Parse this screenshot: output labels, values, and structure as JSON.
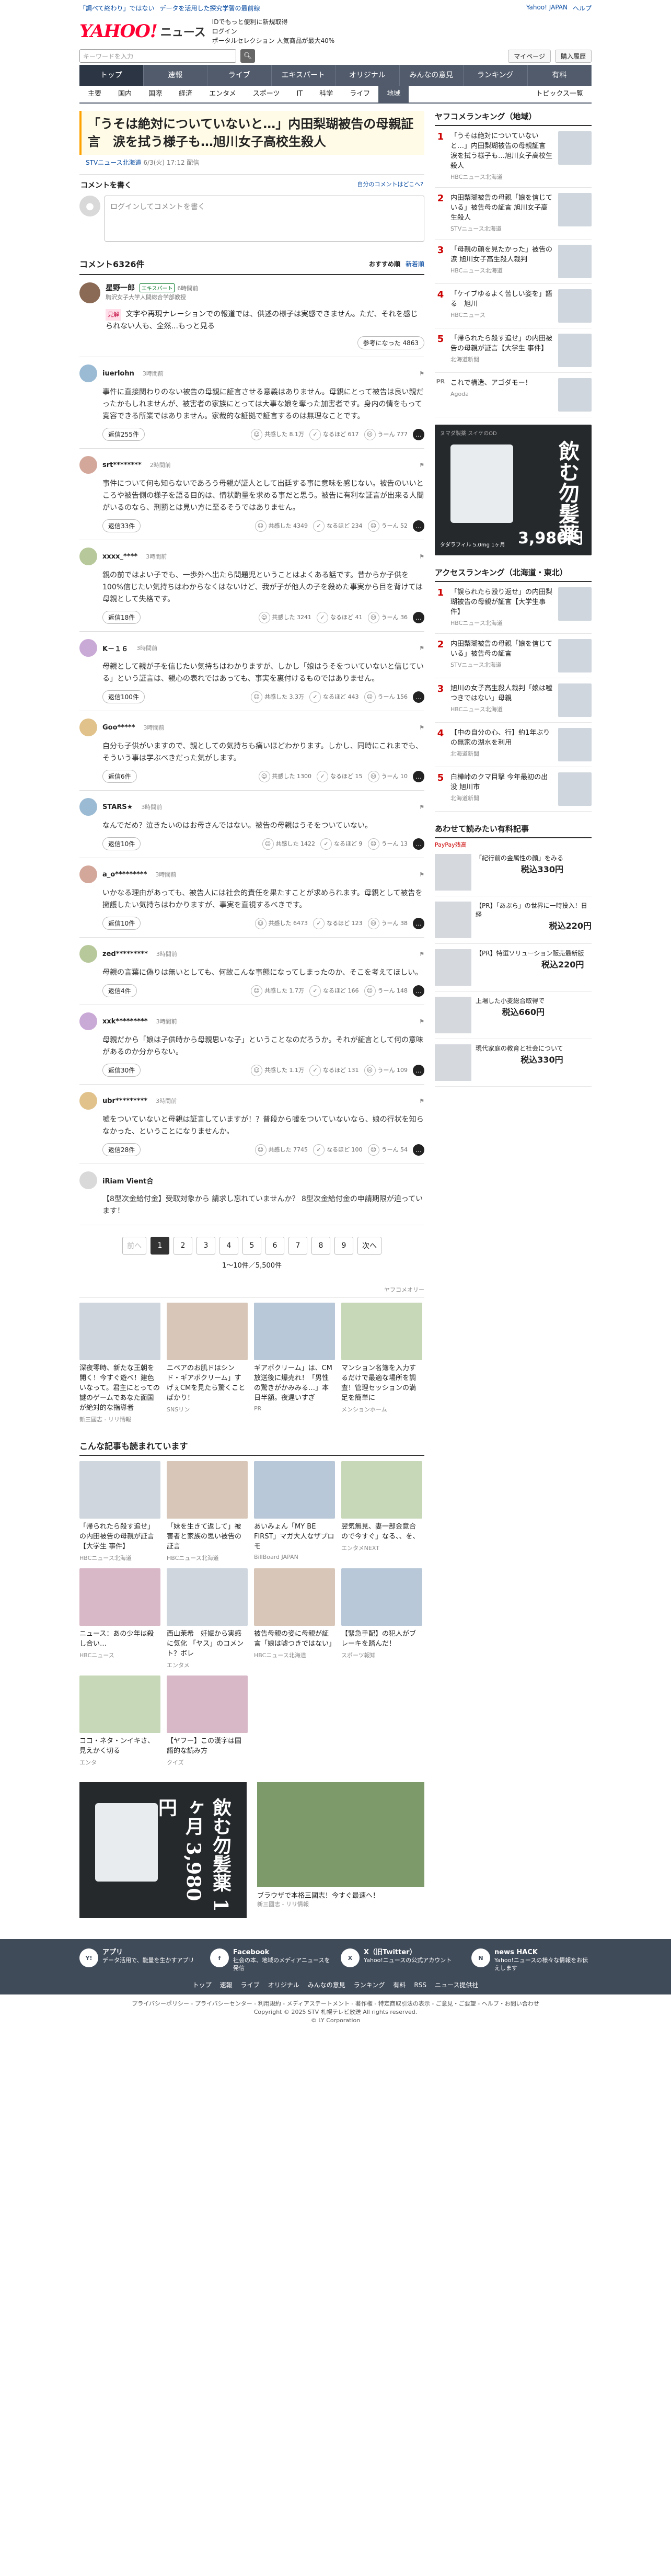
{
  "header": {
    "top_links": [
      "「調べて終わり」ではない",
      "データを活用した探究学習の最前線"
    ],
    "top_right": [
      "Yahoo! JAPAN",
      "ヘルプ"
    ],
    "logo": "YAHOO!",
    "logo_sub": "ニュース",
    "promo_lines": [
      "IDでもっと便利に新規取得",
      "ログイン",
      "ポータルセレクション 人気商品が最大40%"
    ],
    "search_placeholder": "キーワードを入力",
    "search_right": [
      "マイページ",
      "購入履歴"
    ],
    "gnav": [
      "トップ",
      "速報",
      "ライブ",
      "エキスパート",
      "オリジナル",
      "みんなの意見",
      "ランキング",
      "有料"
    ],
    "subnav": [
      "主要",
      "国内",
      "国際",
      "経済",
      "エンタメ",
      "スポーツ",
      "IT",
      "科学",
      "ライフ",
      "地域"
    ],
    "subnav_right": "トピックス一覧"
  },
  "article": {
    "title": "「うそは絶対についていないと…」内田梨瑚被告の母親証言　涙を拭う様子も…旭川女子高校生殺人",
    "source": "STVニュース北海道",
    "date": "6/3(火) 17:12 配信",
    "comment_label": "コメントを書く",
    "comment_policy": "自分のコメントはどこへ?",
    "login_placeholder": "ログインしてコメントを書く"
  },
  "comments_header": {
    "count": "コメント6326件",
    "sort": [
      "おすすめ順",
      "新着順"
    ]
  },
  "expert": {
    "name": "星野一郎",
    "badge": "エキスパート",
    "time": "6時間前",
    "sub": "駒沢女子大学人間総合学部教授",
    "tag": "見解",
    "text": "文字や再現ナレーションでの報道では、供述の様子は実感できません。ただ、それを感じられない人も、全然...もっと見る",
    "likes": "参考になった 4863"
  },
  "comments": [
    {
      "user": "iuerlohn",
      "time": "3時間前",
      "text": "事件に直接関わりのない被告の母親に証言させる意義はありません。母親にとって被告は良い親だったかもしれませんが、被害者の家族にとっては大事な娘を奪った加害者です。身内の情をもって寛容できる所業ではありません。家裁的な証拠で証言するのは無理なことです。",
      "replies": "返信255件",
      "agree": "共感した 8.1万",
      "fair": "なるほど 617",
      "disagree": "うーん 777"
    },
    {
      "user": "srt********",
      "time": "2時間前",
      "text": "事件について何も知らないであろう母親が証人として出廷する事に意味を感じない。被告のいいところや被告側の様子を語る目的は、情状酌量を求める事だと思う。被告に有利な証言が出来る人間がいるのなら、刑罰とは見い方に至るそうではありません。",
      "replies": "返信33件",
      "agree": "共感した 4349",
      "fair": "なるほど 234",
      "disagree": "うーん 52"
    },
    {
      "user": "xxxx_****",
      "time": "3時間前",
      "text": "親の前ではよい子でも、一歩外へ出たら問題児ということはよくある話です。昔からか子供を100%信じたい気持ちはわからなくはないけど、我が子が他人の子を殺めた事実から目を背けては母親として失格です。",
      "replies": "返信18件",
      "agree": "共感した 3241",
      "fair": "なるほど 41",
      "disagree": "うーん 36"
    },
    {
      "user": "K－１６",
      "time": "3時間前",
      "text": "母親として親が子を信じたい気持ちはわかりますが、しかし「娘はうそをついていないと信じている」という証言は、親心の表れではあっても、事実を裏付けるものではありません。",
      "replies": "返信100件",
      "agree": "共感した 3.3万",
      "fair": "なるほど 443",
      "disagree": "うーん 156"
    },
    {
      "user": "Goo*****",
      "time": "3時間前",
      "text": "自分も子供がいますので、親としての気持ちも痛いほどわかります。しかし、同時にこれまでも、そういう事は学ぶべきだった気がします。",
      "replies": "返信6件",
      "agree": "共感した 1300",
      "fair": "なるほど 15",
      "disagree": "うーん 10"
    },
    {
      "user": "STARS★",
      "time": "3時間前",
      "text": "なんでだめ？泣きたいのはお母さんではない。被告の母親はうそをついていない。",
      "replies": "返信10件",
      "agree": "共感した 1422",
      "fair": "なるほど 9",
      "disagree": "うーん 13"
    },
    {
      "user": "a_o*********",
      "time": "3時間前",
      "text": "いかなる理由があっても、被告人には社会的責任を果たすことが求められます。母親として被告を擁護したい気持ちはわかりますが、事実を直視するべきです。",
      "replies": "返信10件",
      "agree": "共感した 6473",
      "fair": "なるほど 123",
      "disagree": "うーん 38"
    },
    {
      "user": "zed*********",
      "time": "3時間前",
      "text": "母親の言葉に偽りは無いとしても、何故こんな事態になってしまったのか、そこを考えてほしい。",
      "replies": "返信4件",
      "agree": "共感した 1.7万",
      "fair": "なるほど 166",
      "disagree": "うーん 148"
    },
    {
      "user": "xxk*********",
      "time": "3時間前",
      "text": "母親だから「娘は子供時から母親思いな子」ということなのだろうか。それが証言として何の意味があるのか分からない。",
      "replies": "返信30件",
      "agree": "共感した 1.1万",
      "fair": "なるほど 131",
      "disagree": "うーん 109"
    },
    {
      "user": "ubr*********",
      "time": "3時間前",
      "text": "嘘をついていないと母親は証言していますが！？普段から嘘をついていないなら、娘の行状を知らなかった、ということになりませんか。",
      "replies": "返信28件",
      "agree": "共感した 7745",
      "fair": "なるほど 100",
      "disagree": "うーん 54"
    }
  ],
  "ad_comment": {
    "text": "【8型次金給付金】受取対象から 請求し忘れていませんか？ 8型次金給付金の申請期限が迫っています！",
    "src": "iRiam Vient合"
  },
  "pager": {
    "prev": "前へ",
    "pages": [
      "1",
      "2",
      "3",
      "4",
      "5",
      "6",
      "7",
      "8",
      "9"
    ],
    "next": "次へ",
    "count": "1〜10件／5,500件"
  },
  "recommend": {
    "label": "ヤフコメオリー",
    "cards": [
      {
        "title": "深夜零時、新たな王朝を開く！今すぐ遊べ！建色いなって。君主にとっての謎のゲームであなた面国が絶対的な指導者",
        "src": "新三國志 - リリ情報"
      },
      {
        "title": "ニベアのお肌ドはシンド・ギアボクリーム」すげぇCMを見たら驚くことばかり！",
        "src": "SNSリン"
      },
      {
        "title": "ギアボクリーム」は、CM放送後に爆売れ！「男性の驚きがかみみる…」本日半額。夜遅いすぎ",
        "src": "PR"
      },
      {
        "title": "マンション名簿を入力するだけで最適な場所を調査！管理セッションの満足を簡単に",
        "src": "メンションホーム"
      }
    ]
  },
  "also_read": {
    "label": "こんな記事も読まれています",
    "cards": [
      {
        "title": "「帰られたら殺す追せ」の内田被告の母親が証言【大学生 事件】",
        "src": "HBCニュース北海道"
      },
      {
        "title": "「妹を生きて返して」被害者と家族の思い被告の証言",
        "src": "HBCニュース北海道"
      },
      {
        "title": "あいみょん「MY BE FIRST」マガ大人なザプロモ",
        "src": "BillBoard JAPAN"
      },
      {
        "title": "翌気無見、妻一部金意合ので今すぐ」なる、、を、",
        "src": "エンタメNEXT"
      },
      {
        "title": "ニュース：あの少年は殺し合い…",
        "src": "HBCニュース"
      },
      {
        "title": "西山茉希　妊娠から実感に気化 「ヤス」のコメント？ボレ",
        "src": "エンタメ"
      },
      {
        "title": "被告母親の姿に母親が証言「娘は嘘つきではない」",
        "src": "HBCニュース北海道"
      },
      {
        "title": "【緊急手配】の犯人がブレーキを踏んだ！",
        "src": "スポーツ報知"
      },
      {
        "title": "ココ・ネタ・ンイキさ、見えかく切る",
        "src": "エンタ"
      },
      {
        "title": "【ヤフー】この漢字は国語的な読み方",
        "src": "クイズ"
      }
    ]
  },
  "bottom_ads": [
    {
      "title": "飲む勿髪薬 1ヶ月 3,980円",
      "src": "PR"
    },
    {
      "title": "ブラウザで本格三國志！今すぐ最速へ！",
      "src": "新三國志 - リリ情報"
    }
  ],
  "sidebar": {
    "local_rank_title": "ヤフコメランキング（地域）",
    "local_rank": [
      {
        "no": "1",
        "sub": "1位",
        "title": "「うそは絶対についていないと…」内田梨瑚被告の母親証言 涙を拭う様子も…旭川女子高校生殺人",
        "meta": "HBCニュース北海道"
      },
      {
        "no": "2",
        "sub": "2位",
        "title": "内田梨瑚被告の母親「娘を信じている」被告母の証言 旭川女子高生殺人",
        "meta": "STVニュース北海道"
      },
      {
        "no": "3",
        "sub": "3位",
        "title": "「母親の顔を見たかった」被告の涙 旭川女子高生殺人裁判",
        "meta": "HBCニュース北海道"
      },
      {
        "no": "4",
        "sub": "4位",
        "title": "「ケイブゆるよく苦しい姿を」語る　旭川",
        "meta": "HBCニュース"
      },
      {
        "no": "5",
        "sub": "5位",
        "title": "「帰られたら殺す追せ」の内田被告の母親が証言【大学生 事件】",
        "meta": "北海道新聞"
      }
    ],
    "pr_title": "これで構造、アゴダモー！",
    "pr_src": "Agoda",
    "access_title": "アクセスランキング（北海道・東北）",
    "access_rank": [
      {
        "no": "1",
        "sub": "",
        "title": "「誤られたら殴り返せ」の内田梨瑚被告の母親が証言【大学生事件】",
        "meta": "HBCニュース北海道"
      },
      {
        "no": "2",
        "sub": "",
        "title": "内田梨瑚被告の母親「娘を信じている」被告母の証言",
        "meta": "STVニュース北海道"
      },
      {
        "no": "3",
        "sub": "",
        "title": "旭川の女子高生殺人裁判「娘は嘘つきではない」母親",
        "meta": "HBCニュース北海道"
      },
      {
        "no": "4",
        "sub": "",
        "title": "【中の自分の心、行】約1年ぶりの無家の湖水を利用",
        "meta": "北海道新聞"
      },
      {
        "no": "5",
        "sub": "",
        "title": "白樺峠のクマ目撃 今年最初の出没 旭川市",
        "meta": "北海道新聞"
      }
    ],
    "shop_title": "あわせて読みたい有料記事",
    "shop_sub": "PayPay残高",
    "shop": [
      {
        "title": "「紀行前の金属性の顔」をみる",
        "price": "税込330円"
      },
      {
        "title": "【PR】「あぶら」の世界に一時投入！日経",
        "price": "税込220円"
      },
      {
        "title": "【PR】特選ソリューション販売最新版",
        "price": "税込220円"
      },
      {
        "title": "上場した小麦総合取得で",
        "price": "税込660円"
      },
      {
        "title": "現代家庭の教育と社会について",
        "price": "税込330円"
      }
    ],
    "ad": {
      "brand": "ヌマダ製薬 スイケのOD",
      "big": "飲む勿髪薬",
      "price": "3,980円",
      "foot": "タダラフィル 5.0mg 1ヶ月"
    }
  },
  "footer": {
    "items": [
      {
        "title": "アプリ",
        "text": "データ活用で、能量を生かすアプリ"
      },
      {
        "title": "Facebook",
        "text": "社会の本、地域のメディアニュースを発信"
      },
      {
        "title": "X（旧Twitter）",
        "text": "Yahoo!ニュースの公式アカウント"
      },
      {
        "title": "news HACK",
        "text": "Yahoo!ニュースの様々な情報をお伝えします"
      }
    ],
    "nav": [
      "トップ",
      "速報",
      "ライブ",
      "オリジナル",
      "みんなの意見",
      "ランキング",
      "有料",
      "RSS",
      "ニュース提供社"
    ],
    "legal1": "プライバシーポリシー - プライバシーセンター - 利用規約 - メディアステートメント - 著作権 - 特定商取引法の表示 - ご意見・ご要望 - ヘルプ・お問い合わせ",
    "legal2": "Copyright © 2025 STV 札幌テレビ放送 All rights reserved.",
    "legal3": "© LY Corporation"
  },
  "colors": {
    "accent": "#ff0033",
    "nav": "#515b6b",
    "link": "#0b4da2",
    "rank": "#cc0000"
  }
}
